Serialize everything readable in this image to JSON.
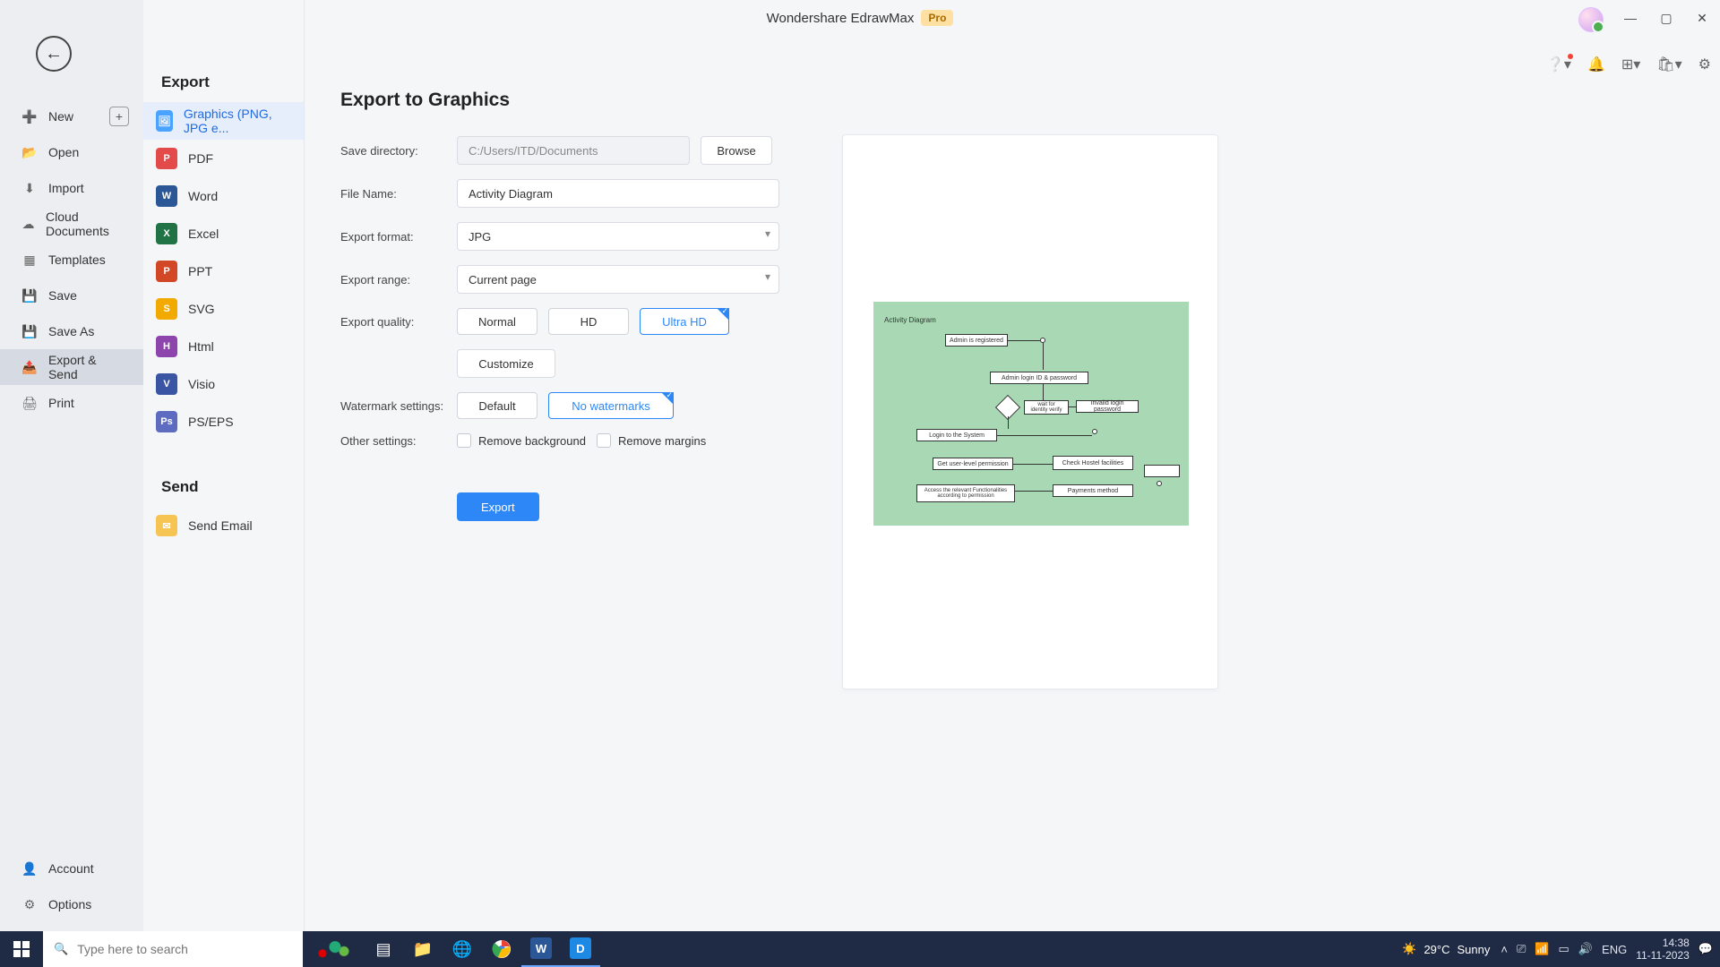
{
  "titlebar": {
    "app_title": "Wondershare EdrawMax",
    "badge": "Pro"
  },
  "leftnav": {
    "items": [
      {
        "label": "New",
        "icon": "plus-square"
      },
      {
        "label": "Open",
        "icon": "folder"
      },
      {
        "label": "Import",
        "icon": "download"
      },
      {
        "label": "Cloud Documents",
        "icon": "cloud"
      },
      {
        "label": "Templates",
        "icon": "template"
      },
      {
        "label": "Save",
        "icon": "save"
      },
      {
        "label": "Save As",
        "icon": "save-as"
      },
      {
        "label": "Export & Send",
        "icon": "export"
      },
      {
        "label": "Print",
        "icon": "print"
      }
    ],
    "bottom": [
      {
        "label": "Account",
        "icon": "user"
      },
      {
        "label": "Options",
        "icon": "gear"
      }
    ]
  },
  "typecol": {
    "heading_export": "Export",
    "heading_send": "Send",
    "export_items": [
      {
        "label": "Graphics (PNG, JPG e...",
        "color": "#4aa3ff"
      },
      {
        "label": "PDF",
        "color": "#e34a4a"
      },
      {
        "label": "Word",
        "color": "#2b5797"
      },
      {
        "label": "Excel",
        "color": "#217346"
      },
      {
        "label": "PPT",
        "color": "#d24726"
      },
      {
        "label": "SVG",
        "color": "#f2a900"
      },
      {
        "label": "Html",
        "color": "#8e44ad"
      },
      {
        "label": "Visio",
        "color": "#3955a3"
      },
      {
        "label": "PS/EPS",
        "color": "#5d6cc0"
      }
    ],
    "send_items": [
      {
        "label": "Send Email",
        "color": "#f6c453"
      }
    ]
  },
  "form": {
    "title": "Export to Graphics",
    "labels": {
      "save_dir": "Save directory:",
      "file_name": "File Name:",
      "export_format": "Export format:",
      "export_range": "Export range:",
      "export_quality": "Export quality:",
      "watermark": "Watermark settings:",
      "other": "Other settings:"
    },
    "save_dir_value": "C:/Users/ITD/Documents",
    "browse_label": "Browse",
    "file_name_value": "Activity Diagram",
    "format_value": "JPG",
    "range_value": "Current page",
    "quality_options": {
      "normal": "Normal",
      "hd": "HD",
      "ultra": "Ultra HD"
    },
    "customize_label": "Customize",
    "watermark_options": {
      "default": "Default",
      "none": "No watermarks"
    },
    "checks": {
      "remove_bg": "Remove background",
      "remove_margins": "Remove margins"
    },
    "export_btn": "Export"
  },
  "preview": {
    "title": "Activity Diagram",
    "boxes": {
      "b1": "Admin is registered",
      "b2": "Admin login ID & password",
      "b3": "wait for identity verify",
      "b4": "Invalid login password",
      "b5": "Login to the System",
      "b6": "Get user-level permission",
      "b7": "Check Hostel facilities",
      "b8": "Access the relevant Functionalities according to permission",
      "b9": "Payments method"
    }
  },
  "taskbar": {
    "search_placeholder": "Type here to search",
    "weather_temp": "29°C",
    "weather_cond": "Sunny",
    "lang": "ENG",
    "time": "14:38",
    "date": "11-11-2023"
  }
}
